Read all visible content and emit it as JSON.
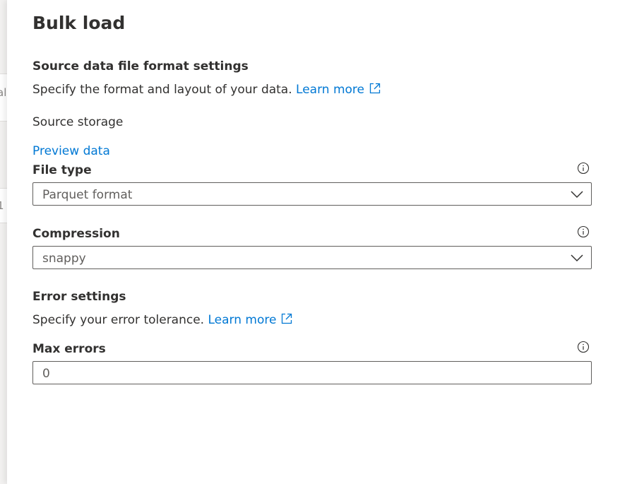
{
  "panel": {
    "title": "Bulk load"
  },
  "source_format": {
    "heading": "Source data file format settings",
    "description": "Specify the format and layout of your data.",
    "learn_more": "Learn more",
    "source_storage_label": "Source storage",
    "preview_link": "Preview data"
  },
  "file_type": {
    "label": "File type",
    "value": "Parquet format"
  },
  "compression": {
    "label": "Compression",
    "value": "snappy"
  },
  "error_settings": {
    "heading": "Error settings",
    "description": "Specify your error tolerance.",
    "learn_more": "Learn more"
  },
  "max_errors": {
    "label": "Max errors",
    "value": "0"
  },
  "icons": {
    "external": "external-link-icon",
    "info": "info-icon",
    "dropdown": "chevron-down-icon"
  },
  "colors": {
    "link": "#0078d4",
    "text": "#323130",
    "border": "#605e5c"
  }
}
